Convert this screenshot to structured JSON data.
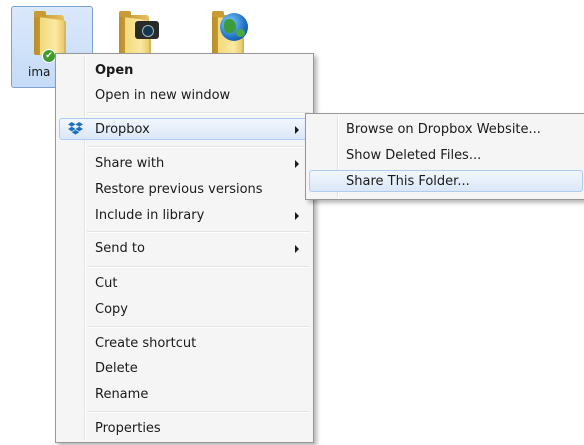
{
  "desktop": {
    "items": [
      {
        "label": "ima",
        "badge": "check-icon",
        "selected": true
      },
      {
        "label": "",
        "badge": "camera-icon",
        "selected": false
      },
      {
        "label": "",
        "badge": "globe-icon",
        "selected": false
      }
    ]
  },
  "context_menu": {
    "open": "Open",
    "open_new_window": "Open in new window",
    "dropbox": "Dropbox",
    "share_with": "Share with",
    "restore_previous": "Restore previous versions",
    "include_library": "Include in library",
    "send_to": "Send to",
    "cut": "Cut",
    "copy": "Copy",
    "create_shortcut": "Create shortcut",
    "delete": "Delete",
    "rename": "Rename",
    "properties": "Properties"
  },
  "dropbox_submenu": {
    "browse": "Browse on Dropbox Website...",
    "deleted_files": "Show Deleted Files...",
    "share_folder": "Share This Folder..."
  },
  "colors": {
    "dropbox_blue": "#1f6fbf",
    "highlight_border": "#aecbf0",
    "menu_bg": "#f5f5f5"
  }
}
